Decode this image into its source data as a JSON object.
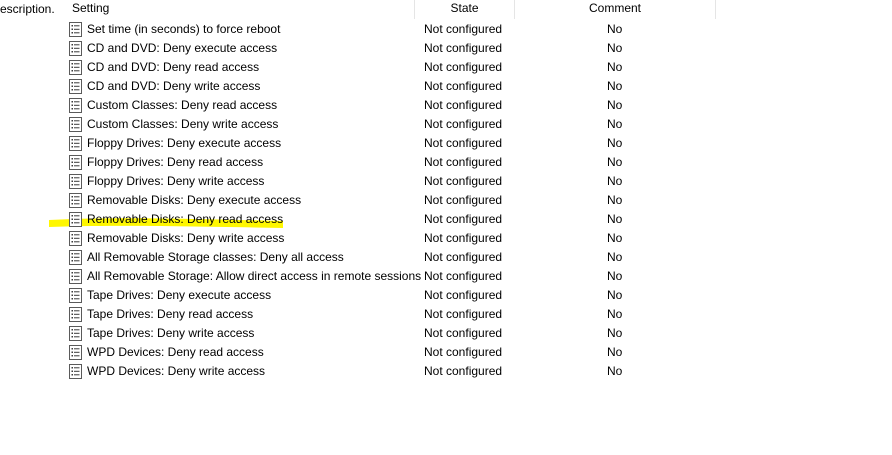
{
  "left_column_fragment": "escription.",
  "header": {
    "setting": "Setting",
    "state": "State",
    "comment": "Comment"
  },
  "rows": [
    {
      "name": "Set time (in seconds) to force reboot",
      "state": "Not configured",
      "comment": "No"
    },
    {
      "name": "CD and DVD: Deny execute access",
      "state": "Not configured",
      "comment": "No"
    },
    {
      "name": "CD and DVD: Deny read access",
      "state": "Not configured",
      "comment": "No"
    },
    {
      "name": "CD and DVD: Deny write access",
      "state": "Not configured",
      "comment": "No"
    },
    {
      "name": "Custom Classes: Deny read access",
      "state": "Not configured",
      "comment": "No"
    },
    {
      "name": "Custom Classes: Deny write access",
      "state": "Not configured",
      "comment": "No"
    },
    {
      "name": "Floppy Drives: Deny execute access",
      "state": "Not configured",
      "comment": "No"
    },
    {
      "name": "Floppy Drives: Deny read access",
      "state": "Not configured",
      "comment": "No"
    },
    {
      "name": "Floppy Drives: Deny write access",
      "state": "Not configured",
      "comment": "No"
    },
    {
      "name": "Removable Disks: Deny execute access",
      "state": "Not configured",
      "comment": "No"
    },
    {
      "name": "Removable Disks: Deny read access",
      "state": "Not configured",
      "comment": "No"
    },
    {
      "name": "Removable Disks: Deny write access",
      "state": "Not configured",
      "comment": "No"
    },
    {
      "name": "All Removable Storage classes: Deny all access",
      "state": "Not configured",
      "comment": "No"
    },
    {
      "name": "All Removable Storage: Allow direct access in remote sessions",
      "state": "Not configured",
      "comment": "No"
    },
    {
      "name": "Tape Drives: Deny execute access",
      "state": "Not configured",
      "comment": "No"
    },
    {
      "name": "Tape Drives: Deny read access",
      "state": "Not configured",
      "comment": "No"
    },
    {
      "name": "Tape Drives: Deny write access",
      "state": "Not configured",
      "comment": "No"
    },
    {
      "name": "WPD Devices: Deny read access",
      "state": "Not configured",
      "comment": "No"
    },
    {
      "name": "WPD Devices: Deny write access",
      "state": "Not configured",
      "comment": "No"
    }
  ],
  "highlighted_row_index": 10,
  "icon": "policy-setting-icon",
  "highlight_color": "#fff700"
}
